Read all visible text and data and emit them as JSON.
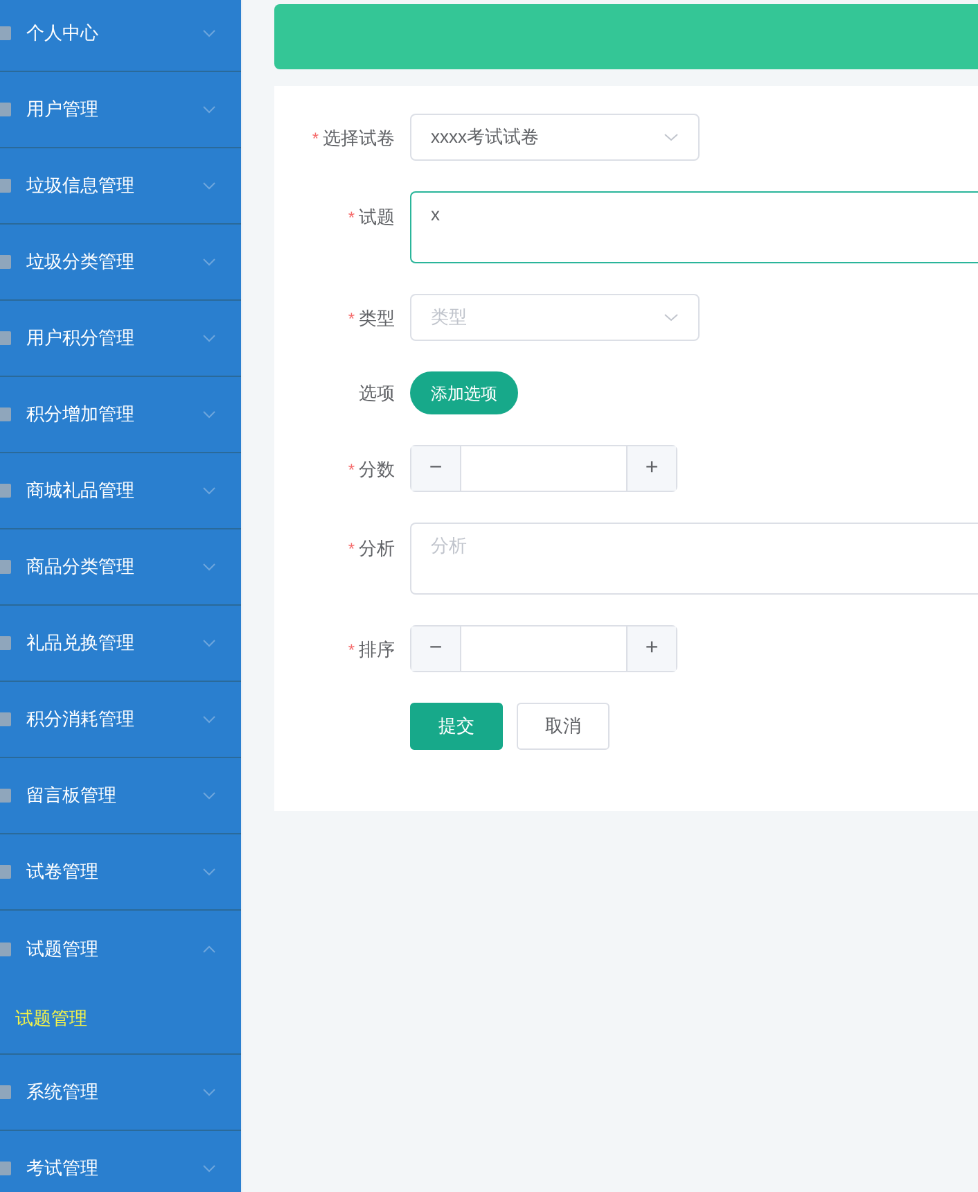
{
  "sidebar": {
    "items": [
      {
        "label": "个人中心",
        "expanded": false
      },
      {
        "label": "用户管理",
        "expanded": false
      },
      {
        "label": "垃圾信息管理",
        "expanded": false
      },
      {
        "label": "垃圾分类管理",
        "expanded": false
      },
      {
        "label": "用户积分管理",
        "expanded": false
      },
      {
        "label": "积分增加管理",
        "expanded": false
      },
      {
        "label": "商城礼品管理",
        "expanded": false
      },
      {
        "label": "商品分类管理",
        "expanded": false
      },
      {
        "label": "礼品兑换管理",
        "expanded": false
      },
      {
        "label": "积分消耗管理",
        "expanded": false
      },
      {
        "label": "留言板管理",
        "expanded": false
      },
      {
        "label": "试卷管理",
        "expanded": false
      },
      {
        "label": "试题管理",
        "expanded": true,
        "children": [
          {
            "label": "试题管理",
            "selected": true
          }
        ]
      },
      {
        "label": "系统管理",
        "expanded": false
      },
      {
        "label": "考试管理",
        "expanded": false
      }
    ]
  },
  "form": {
    "fields": [
      {
        "kind": "select",
        "label": "选择试卷",
        "required_mark": "*",
        "value": "xxxx考试试卷"
      },
      {
        "kind": "textarea",
        "label": "试题",
        "required_mark": "*",
        "value": "x",
        "focused": true
      },
      {
        "kind": "select",
        "label": "类型",
        "required_mark": "*",
        "placeholder": "类型"
      },
      {
        "kind": "action",
        "label": "选项",
        "button": "添加选项"
      },
      {
        "kind": "number",
        "label": "分数",
        "required_mark": "*",
        "minus": "−",
        "plus": "+"
      },
      {
        "kind": "textarea",
        "label": "分析",
        "required_mark": "*",
        "placeholder": "分析",
        "focused": false
      },
      {
        "kind": "number",
        "label": "排序",
        "required_mark": "*",
        "minus": "−",
        "plus": "+"
      }
    ],
    "buttons": [
      {
        "label": "提交",
        "kind": "primary"
      },
      {
        "label": "取消",
        "kind": "default"
      }
    ]
  }
}
